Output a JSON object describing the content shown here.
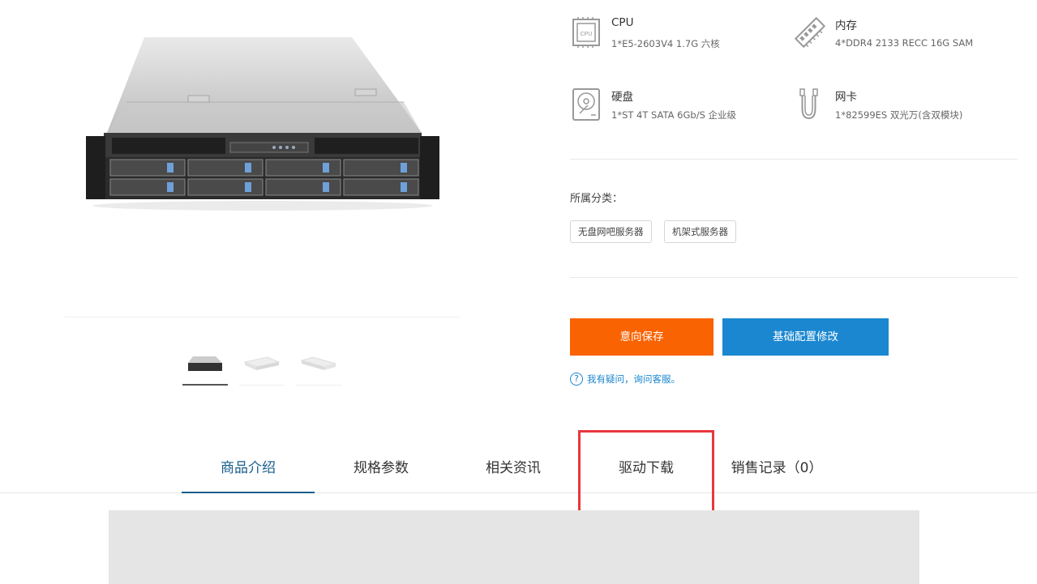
{
  "product": {
    "thumbnails": [
      {
        "name": "thumb-1",
        "active": true
      },
      {
        "name": "thumb-2",
        "active": false
      },
      {
        "name": "thumb-3",
        "active": false
      }
    ]
  },
  "specs": [
    {
      "icon": "cpu-icon",
      "label": "CPU",
      "value": "1*E5-2603V4 1.7G 六核"
    },
    {
      "icon": "memory-icon",
      "label": "内存",
      "value": "4*DDR4 2133 RECC 16G SAM"
    },
    {
      "icon": "hard-disk-icon",
      "label": "硬盘",
      "value": "1*ST 4T SATA 6Gb/S 企业级"
    },
    {
      "icon": "network-card-icon",
      "label": "网卡",
      "value": "1*82599ES 双光万(含双模块)"
    }
  ],
  "category": {
    "label": "所属分类：",
    "tags": [
      "无盘网吧服务器",
      "机架式服务器"
    ]
  },
  "actions": {
    "save_label": "意向保存",
    "config_label": "基础配置修改",
    "help_text": "我有疑问，询问客服。",
    "help_icon_glyph": "?"
  },
  "tabs": [
    {
      "label": "商品介绍",
      "active": true
    },
    {
      "label": "规格参数",
      "active": false
    },
    {
      "label": "相关资讯",
      "active": false
    },
    {
      "label": "驱动下载",
      "active": false
    },
    {
      "label": "销售记录（0）",
      "active": false
    }
  ],
  "colors": {
    "accent_orange": "#f96302",
    "accent_blue": "#1a87d0",
    "tab_active": "#1a5d8c",
    "highlight_red": "#e8373d"
  }
}
